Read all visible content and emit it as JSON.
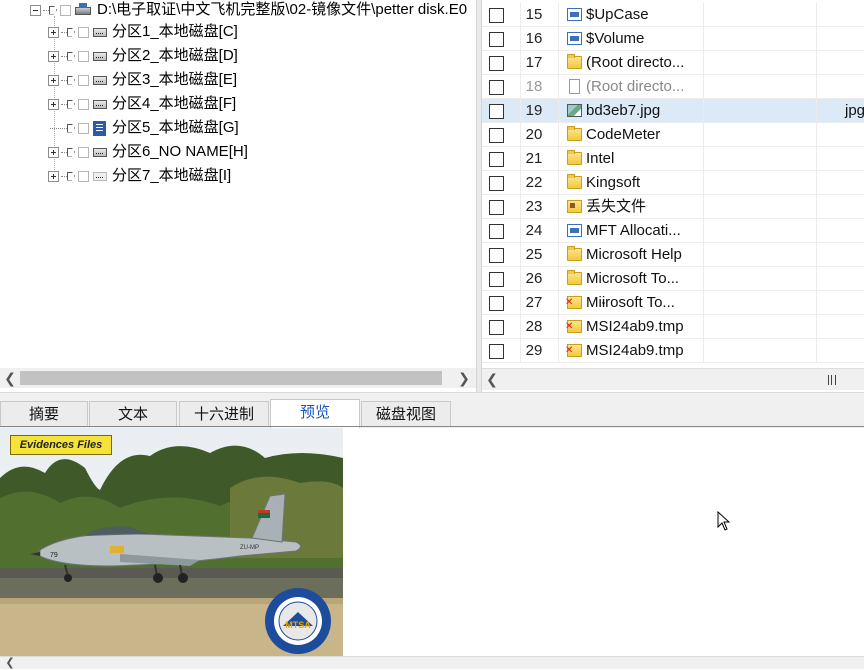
{
  "tree": {
    "root_label": "D:\\电子取证\\中文飞机完整版\\02-镜像文件\\petter disk.E0",
    "partitions": [
      {
        "label": "分区1_本地磁盘[C]",
        "icon": "hard-drive-icon"
      },
      {
        "label": "分区2_本地磁盘[D]",
        "icon": "hard-drive-icon"
      },
      {
        "label": "分区3_本地磁盘[E]",
        "icon": "hard-drive-icon"
      },
      {
        "label": "分区4_本地磁盘[F]",
        "icon": "hard-drive-icon"
      },
      {
        "label": "分区5_本地磁盘[G]",
        "icon": "blue-partition-icon"
      },
      {
        "label": "分区6_NO NAME[H]",
        "icon": "hard-drive-icon"
      },
      {
        "label": "分区7_本地磁盘[I]",
        "icon": "hard-drive-icon"
      }
    ]
  },
  "file_list": {
    "rows": [
      {
        "num": "15",
        "name": "$UpCase",
        "icon": "system-file-icon"
      },
      {
        "num": "16",
        "name": "$Volume",
        "icon": "system-file-icon"
      },
      {
        "num": "17",
        "name": "(Root directo...",
        "icon": "folder-icon"
      },
      {
        "num": "18",
        "name": "(Root directo...",
        "icon": "blank-file-icon"
      },
      {
        "num": "19",
        "name": "bd3eb7.jpg",
        "icon": "image-file-icon",
        "type": "jpg",
        "selected": true
      },
      {
        "num": "20",
        "name": "CodeMeter",
        "icon": "folder-icon"
      },
      {
        "num": "21",
        "name": "Intel",
        "icon": "folder-icon"
      },
      {
        "num": "22",
        "name": "Kingsoft",
        "icon": "folder-icon"
      },
      {
        "num": "23",
        "name": "丢失文件",
        "icon": "lost-files-icon"
      },
      {
        "num": "24",
        "name": "MFT Allocati...",
        "icon": "system-file-icon"
      },
      {
        "num": "25",
        "name": "Microsoft Help",
        "icon": "folder-icon"
      },
      {
        "num": "26",
        "name": "Microsoft To...",
        "icon": "folder-icon"
      },
      {
        "num": "27",
        "name": "Miɨrosoft To...",
        "icon": "deleted-folder-icon"
      },
      {
        "num": "28",
        "name": "MSI24ab9.tmp",
        "icon": "deleted-folder-icon"
      },
      {
        "num": "29",
        "name": "MSI24ab9.tmp",
        "icon": "deleted-folder-icon"
      }
    ]
  },
  "tabs": [
    {
      "label": "摘要",
      "active": false
    },
    {
      "label": "文本",
      "active": false
    },
    {
      "label": "十六进制",
      "active": false
    },
    {
      "label": "预览",
      "active": true
    },
    {
      "label": "磁盘视图",
      "active": false
    }
  ],
  "preview": {
    "badge_text": "Evidences Files",
    "plane_number": "79",
    "plane_tail_code": "ZU-MP",
    "emblem_text": "MTSA"
  },
  "colors": {
    "selected_row": "#dce9f7",
    "active_tab_text": "#1a54c4",
    "badge_yellow": "#f6e33a"
  }
}
